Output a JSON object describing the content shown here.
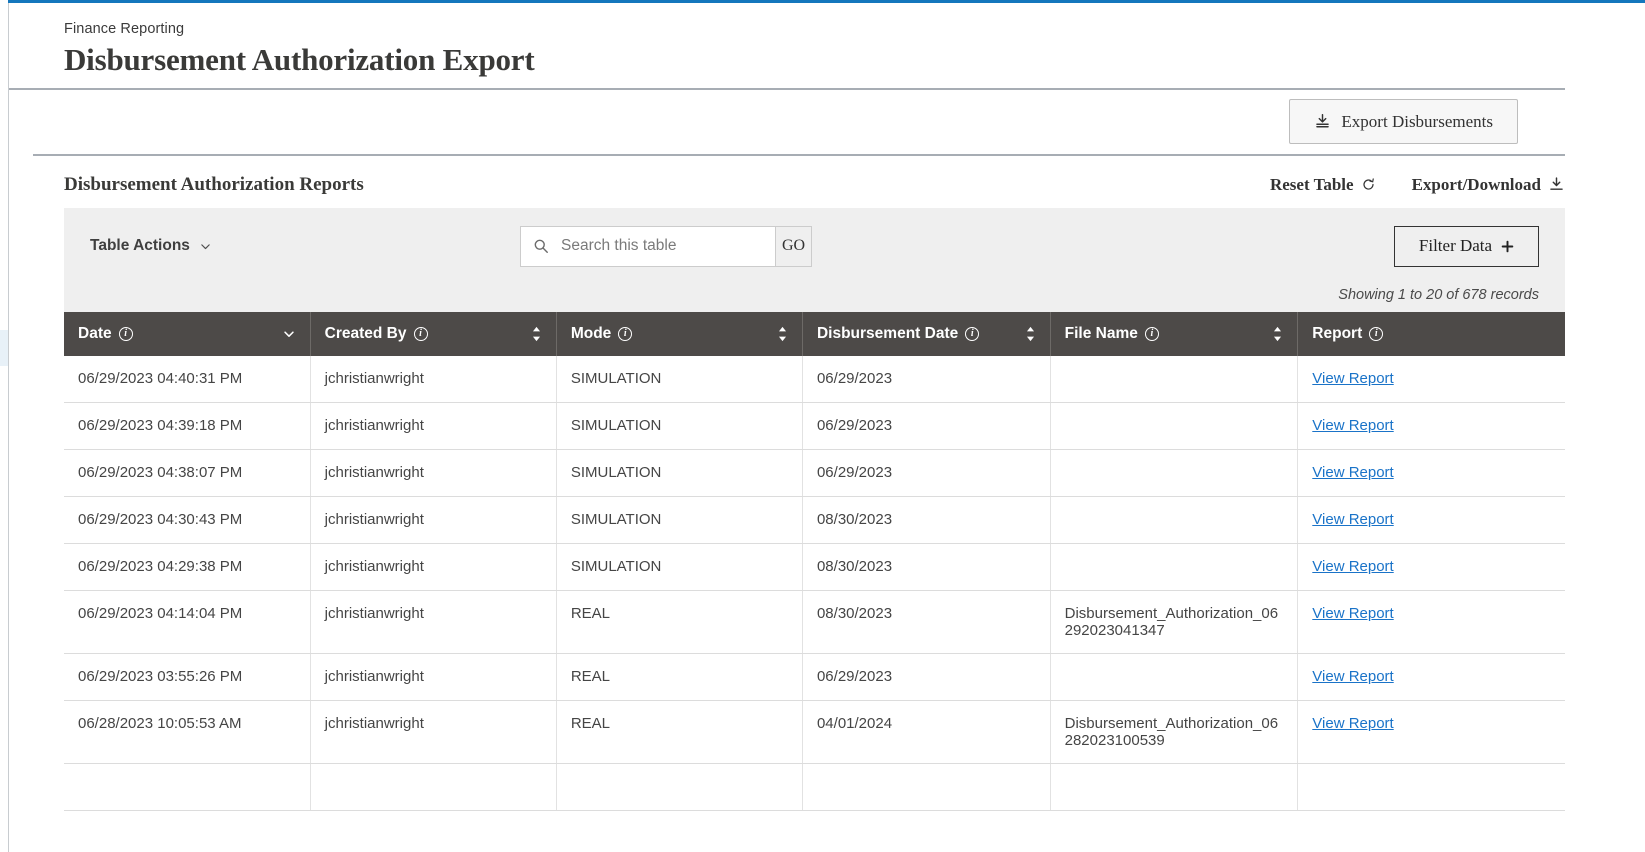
{
  "theme": {
    "accent": "#1477bd",
    "header_bg": "#4d4a48",
    "link": "#1a73c8",
    "toolbar_bg": "#efefef"
  },
  "header": {
    "breadcrumb": "Finance Reporting",
    "title": "Disbursement Authorization Export"
  },
  "action_bar": {
    "export_button_label": "Export Disbursements"
  },
  "panel": {
    "title": "Disbursement Authorization Reports",
    "reset_label": "Reset Table",
    "export_download_label": "Export/Download"
  },
  "toolbar": {
    "table_actions_label": "Table Actions",
    "search_placeholder": "Search this table",
    "search_value": "",
    "go_label": "GO",
    "filter_label": "Filter Data",
    "records_note": "Showing 1 to 20 of 678 records"
  },
  "table": {
    "columns": [
      {
        "label": "Date",
        "sort": "desc",
        "width": "16.4%"
      },
      {
        "label": "Created By",
        "sort": "none",
        "width": "16.4%"
      },
      {
        "label": "Mode",
        "sort": "none",
        "width": "16.4%"
      },
      {
        "label": "Disbursement Date",
        "sort": "none",
        "width": "16.5%"
      },
      {
        "label": "File Name",
        "sort": "none",
        "width": "16.5%"
      },
      {
        "label": "Report",
        "sort": null,
        "width": "17.8%"
      }
    ],
    "rows": [
      {
        "date": "06/29/2023 04:40:31 PM",
        "created_by": "jchristianwright",
        "mode": "SIMULATION",
        "disbursement_date": "06/29/2023",
        "file_name": "",
        "report": "View Report",
        "tall": false
      },
      {
        "date": "06/29/2023 04:39:18 PM",
        "created_by": "jchristianwright",
        "mode": "SIMULATION",
        "disbursement_date": "06/29/2023",
        "file_name": "",
        "report": "View Report",
        "tall": false
      },
      {
        "date": "06/29/2023 04:38:07 PM",
        "created_by": "jchristianwright",
        "mode": "SIMULATION",
        "disbursement_date": "06/29/2023",
        "file_name": "",
        "report": "View Report",
        "tall": false
      },
      {
        "date": "06/29/2023 04:30:43 PM",
        "created_by": "jchristianwright",
        "mode": "SIMULATION",
        "disbursement_date": "08/30/2023",
        "file_name": "",
        "report": "View Report",
        "tall": false
      },
      {
        "date": "06/29/2023 04:29:38 PM",
        "created_by": "jchristianwright",
        "mode": "SIMULATION",
        "disbursement_date": "08/30/2023",
        "file_name": "",
        "report": "View Report",
        "tall": false
      },
      {
        "date": "06/29/2023 04:14:04 PM",
        "created_by": "jchristianwright",
        "mode": "REAL",
        "disbursement_date": "08/30/2023",
        "file_name": "Disbursement_Authorization_06292023041347",
        "report": "View Report",
        "tall": true
      },
      {
        "date": "06/29/2023 03:55:26 PM",
        "created_by": "jchristianwright",
        "mode": "REAL",
        "disbursement_date": "06/29/2023",
        "file_name": "",
        "report": "View Report",
        "tall": false
      },
      {
        "date": "06/28/2023 10:05:53 AM",
        "created_by": "jchristianwright",
        "mode": "REAL",
        "disbursement_date": "04/01/2024",
        "file_name": "Disbursement_Authorization_06282023100539",
        "report": "View Report",
        "tall": true
      },
      {
        "date": "",
        "created_by": "",
        "mode": "",
        "disbursement_date": "",
        "file_name": "",
        "report": "",
        "tall": false
      }
    ]
  },
  "icons": {
    "export": "download-tray-icon",
    "reset": "refresh-icon",
    "download": "download-icon",
    "search": "search-icon",
    "chevron": "chevron-down-icon",
    "plus": "plus-icon",
    "info": "info-icon",
    "sort": "sort-arrows-icon"
  }
}
